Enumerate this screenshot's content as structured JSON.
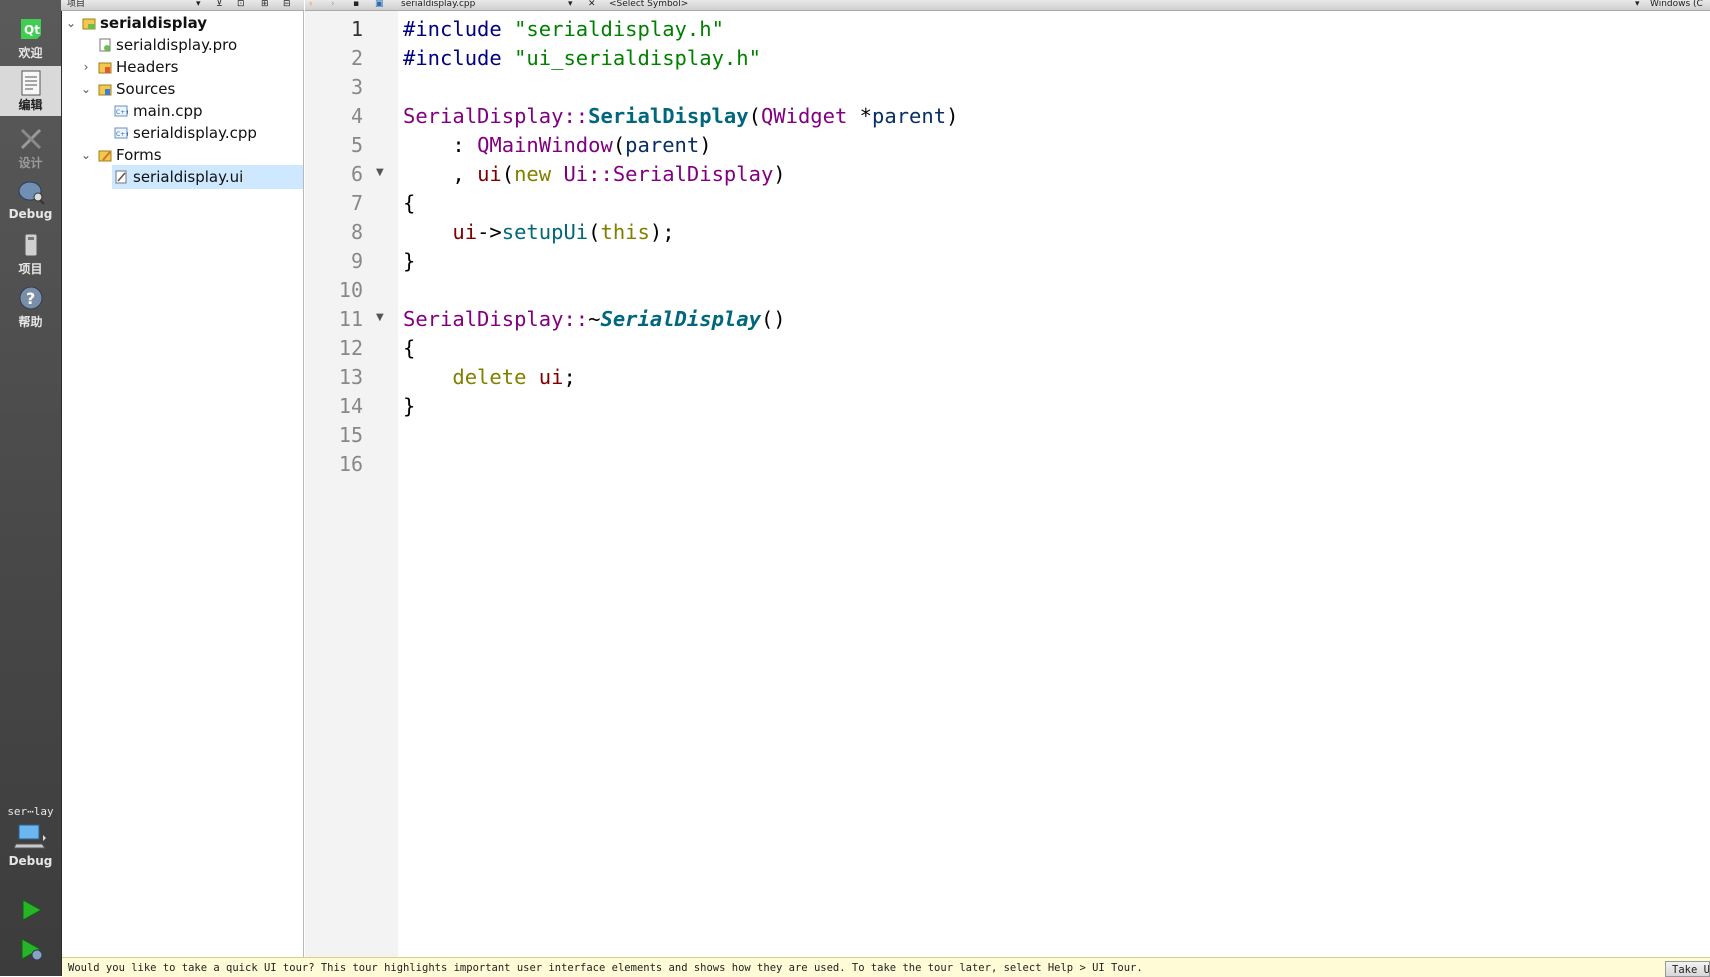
{
  "colors": {
    "modebar": "#474747",
    "selection": "#cde8ff",
    "gutter": "#f3f3f3",
    "tour_bg": "#fffbd6",
    "run_green": "#28b428"
  },
  "modebar": {
    "modes": [
      {
        "label": "欢迎",
        "icon": "qt-logo-icon"
      },
      {
        "label": "编辑",
        "icon": "edit-document-icon",
        "active": true
      },
      {
        "label": "设计",
        "icon": "design-tools-icon",
        "disabled": true
      },
      {
        "label": "Debug",
        "icon": "debug-bug-icon"
      },
      {
        "label": "项目",
        "icon": "project-wrench-icon"
      },
      {
        "label": "帮助",
        "icon": "help-question-icon"
      }
    ],
    "target": {
      "name": "ser⋯lay",
      "mode": "Debug",
      "icon": "kit-computer-icon"
    },
    "run_icon": "run-play-icon",
    "debug_run_icon": "debug-run-icon"
  },
  "top_left_bar": {
    "title": "项目"
  },
  "editor_bar": {
    "file": "serialdisplay.cpp",
    "symbol": "<Select Symbol>",
    "line_ending": "Windows (C"
  },
  "tree": {
    "items": [
      {
        "label": "serialdisplay",
        "icon": "project-folder-icon",
        "bold": true,
        "expanded": true,
        "level": 0
      },
      {
        "label": "serialdisplay.pro",
        "icon": "pro-file-icon",
        "level": 1
      },
      {
        "label": "Headers",
        "icon": "headers-folder-icon",
        "collapsed": true,
        "level": 1
      },
      {
        "label": "Sources",
        "icon": "sources-folder-icon",
        "expanded": true,
        "level": 1
      },
      {
        "label": "main.cpp",
        "icon": "cpp-file-icon",
        "level": 2
      },
      {
        "label": "serialdisplay.cpp",
        "icon": "cpp-file-icon",
        "level": 2
      },
      {
        "label": "Forms",
        "icon": "forms-folder-icon",
        "expanded": true,
        "level": 1
      },
      {
        "label": "serialdisplay.ui",
        "icon": "ui-file-icon",
        "level": 2,
        "selected": true
      }
    ]
  },
  "editor": {
    "current_line": 1,
    "lines": [
      {
        "n": "1",
        "tokens": [
          {
            "t": "#include",
            "c": "pp"
          },
          {
            "t": " "
          },
          {
            "t": "\"serialdisplay.h\"",
            "c": "str"
          }
        ]
      },
      {
        "n": "2",
        "tokens": [
          {
            "t": "#include",
            "c": "pp"
          },
          {
            "t": " "
          },
          {
            "t": "\"ui_serialdisplay.h\"",
            "c": "str"
          }
        ]
      },
      {
        "n": "3",
        "tokens": []
      },
      {
        "n": "4",
        "tokens": [
          {
            "t": "SerialDisplay",
            "c": "type"
          },
          {
            "t": "::",
            "c": "type"
          },
          {
            "t": "SerialDisplay",
            "c": "fnb"
          },
          {
            "t": "("
          },
          {
            "t": "QWidget",
            "c": "type"
          },
          {
            "t": " *"
          },
          {
            "t": "parent",
            "c": "par"
          },
          {
            "t": ")"
          }
        ]
      },
      {
        "n": "5",
        "tokens": [
          {
            "t": "    : "
          },
          {
            "t": "QMainWindow",
            "c": "type"
          },
          {
            "t": "("
          },
          {
            "t": "parent",
            "c": "par"
          },
          {
            "t": ")"
          }
        ]
      },
      {
        "n": "6",
        "fold": true,
        "tokens": [
          {
            "t": "    , "
          },
          {
            "t": "ui",
            "c": "mem"
          },
          {
            "t": "("
          },
          {
            "t": "new",
            "c": "kw"
          },
          {
            "t": " "
          },
          {
            "t": "Ui",
            "c": "type"
          },
          {
            "t": "::",
            "c": "type"
          },
          {
            "t": "SerialDisplay",
            "c": "type"
          },
          {
            "t": ")"
          }
        ]
      },
      {
        "n": "7",
        "tokens": [
          {
            "t": "{"
          }
        ]
      },
      {
        "n": "8",
        "tokens": [
          {
            "t": "    "
          },
          {
            "t": "ui",
            "c": "mem"
          },
          {
            "t": "->"
          },
          {
            "t": "setupUi",
            "c": "fn"
          },
          {
            "t": "("
          },
          {
            "t": "this",
            "c": "kw"
          },
          {
            "t": ");"
          }
        ]
      },
      {
        "n": "9",
        "tokens": [
          {
            "t": "}"
          }
        ]
      },
      {
        "n": "10",
        "tokens": []
      },
      {
        "n": "11",
        "fold": true,
        "tokens": [
          {
            "t": "SerialDisplay",
            "c": "type"
          },
          {
            "t": "::",
            "c": "type"
          },
          {
            "t": "~"
          },
          {
            "t": "SerialDisplay",
            "c": "fni"
          },
          {
            "t": "()"
          }
        ]
      },
      {
        "n": "12",
        "tokens": [
          {
            "t": "{"
          }
        ]
      },
      {
        "n": "13",
        "tokens": [
          {
            "t": "    "
          },
          {
            "t": "delete",
            "c": "kw"
          },
          {
            "t": " "
          },
          {
            "t": "ui",
            "c": "mem"
          },
          {
            "t": ";"
          }
        ]
      },
      {
        "n": "14",
        "tokens": [
          {
            "t": "}"
          }
        ]
      },
      {
        "n": "15",
        "tokens": []
      },
      {
        "n": "16",
        "tokens": []
      }
    ]
  },
  "tour": {
    "text": "Would you like to take a quick UI tour? This tour highlights important user interface elements and shows how they are used. To take the tour later, select Help > UI Tour.",
    "button": "Take UI Tour"
  }
}
